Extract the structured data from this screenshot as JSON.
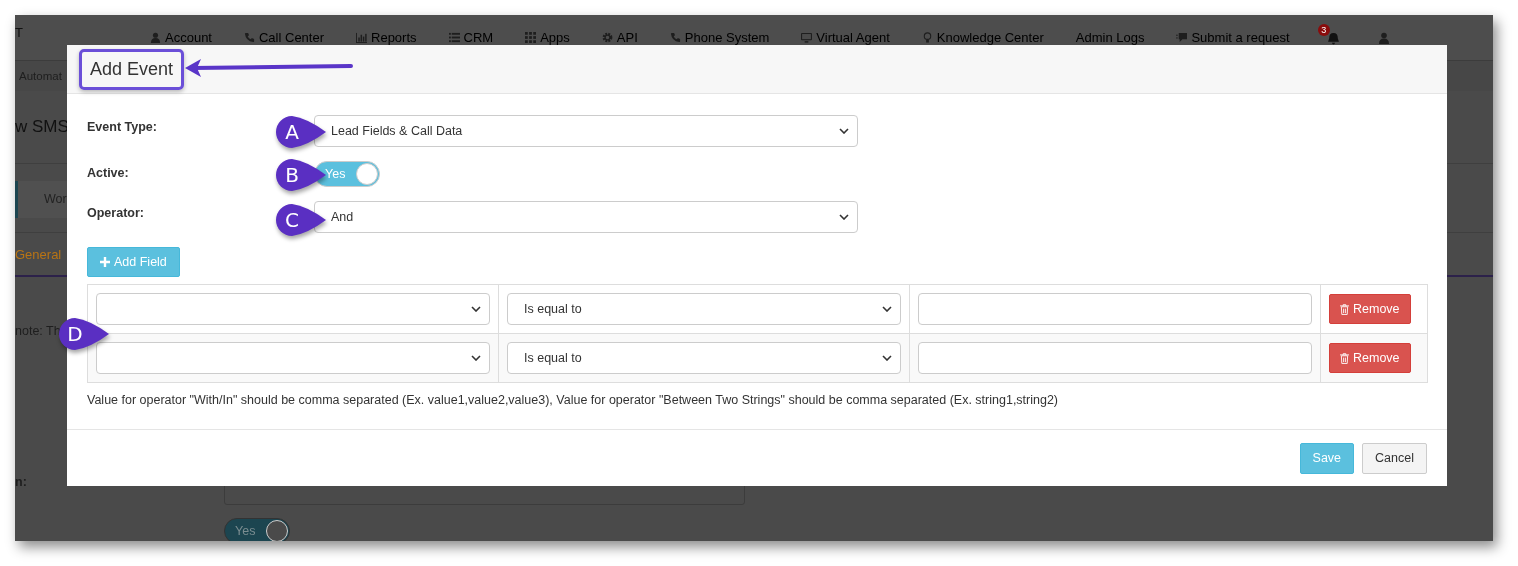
{
  "nav": {
    "brand": "T",
    "items": [
      {
        "label": "Account"
      },
      {
        "label": "Call Center"
      },
      {
        "label": "Reports"
      },
      {
        "label": "CRM"
      },
      {
        "label": "Apps"
      },
      {
        "label": "API"
      },
      {
        "label": "Phone System"
      },
      {
        "label": "Virtual Agent"
      },
      {
        "label": "Knowledge Center"
      },
      {
        "label": "Admin Logs"
      },
      {
        "label": "Submit a request"
      }
    ],
    "notification_count": "3"
  },
  "background": {
    "breadcrumb": "Automat",
    "heading": "w SMS",
    "tab": "Wor",
    "section_tab": "General",
    "note": "note: Th",
    "field_label": "n:",
    "toggle": {
      "label": "Yes",
      "on": true
    }
  },
  "modal": {
    "title": "Add Event",
    "fields": [
      {
        "kind": "select",
        "label": "Event Type:",
        "value": "Lead Fields & Call Data"
      },
      {
        "kind": "toggle",
        "label": "Active:",
        "value": "Yes",
        "on": true
      },
      {
        "kind": "select",
        "label": "Operator:",
        "value": "And"
      }
    ],
    "add_button": "Add Field",
    "rows": [
      {
        "operator": "Is equal to",
        "remove": "Remove"
      },
      {
        "operator": "Is equal to",
        "remove": "Remove"
      }
    ],
    "hint": "Value for operator \"With/In\" should be comma separated (Ex. value1,value2,value3), Value for operator \"Between Two Strings\" should be comma separated (Ex. string1,string2)",
    "buttons": [
      {
        "label": "Save",
        "kind": "primary"
      },
      {
        "label": "Cancel",
        "kind": "default"
      }
    ]
  },
  "callouts": [
    {
      "label": "A"
    },
    {
      "label": "B"
    },
    {
      "label": "C"
    },
    {
      "label": "D"
    }
  ]
}
